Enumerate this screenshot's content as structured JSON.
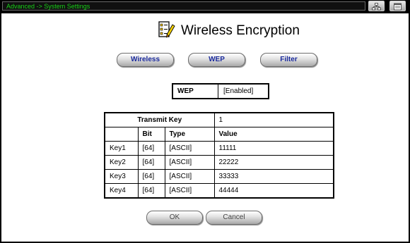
{
  "header": {
    "breadcrumb": "Advanced -> System Settings",
    "icons": [
      "network-icon",
      "window-icon"
    ]
  },
  "page": {
    "title": "Wireless Encryption",
    "title_icon": "checklist-pencil-icon"
  },
  "nav_buttons": {
    "wireless": "Wireless",
    "wep": "WEP",
    "filter": "Filter"
  },
  "wep_status": {
    "label": "WEP",
    "value": "[Enabled]"
  },
  "key_table": {
    "transmit_key_label": "Transmit Key",
    "transmit_key_value": "1",
    "columns": [
      "",
      "Bit",
      "Type",
      "Value"
    ],
    "rows": [
      {
        "key": "Key1",
        "bit": "[64]",
        "type": "[ASCII]",
        "value": "11111"
      },
      {
        "key": "Key2",
        "bit": "[64]",
        "type": "[ASCII]",
        "value": "22222"
      },
      {
        "key": "Key3",
        "bit": "[64]",
        "type": "[ASCII]",
        "value": "33333"
      },
      {
        "key": "Key4",
        "bit": "[64]",
        "type": "[ASCII]",
        "value": "44444"
      }
    ]
  },
  "actions": {
    "ok": "OK",
    "cancel": "Cancel"
  },
  "colors": {
    "breadcrumb_text": "#19d119",
    "button_text": "#1a2a9c",
    "background": "#ffffff",
    "frame": "#000000"
  }
}
